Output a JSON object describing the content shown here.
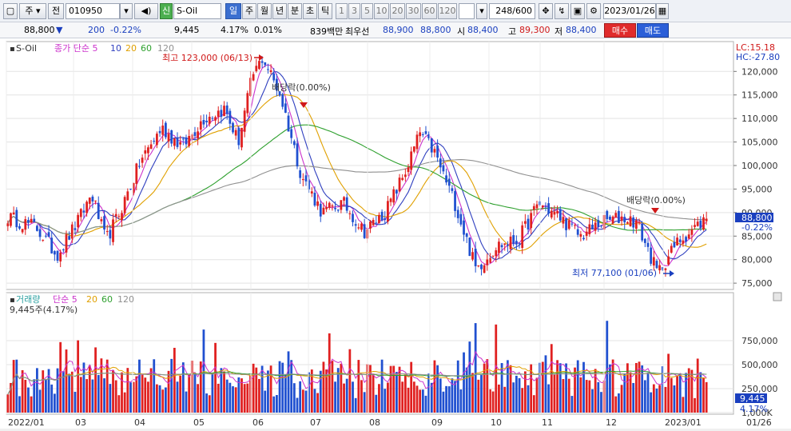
{
  "toolbar": {
    "code": "010950",
    "stock_name": "S-Oil",
    "type_label": "주",
    "jeon_label": "전",
    "sin_label": "신",
    "period_tabs": [
      "일",
      "주",
      "월",
      "년",
      "분",
      "초",
      "틱"
    ],
    "active_period": "일",
    "intervals": [
      "1",
      "3",
      "5",
      "10",
      "20",
      "30",
      "60",
      "120"
    ],
    "count_display": "248/600",
    "date": "2023/01/26"
  },
  "quote": {
    "price": "88,800",
    "change_arrow": "▼",
    "change": "200",
    "change_pct": "-0.22%",
    "volume": "9,445",
    "volume_pct": "4.17%",
    "turnover_pct": "0.01%",
    "amount": "839백만",
    "best_bid_label": "최우선",
    "best_ask": "88,900",
    "best_bid": "88,800",
    "open_label": "시",
    "open": "88,400",
    "high_label": "고",
    "high": "89,300",
    "low_label": "저",
    "low": "88,400",
    "buy_label": "매수",
    "sell_label": "매도"
  },
  "price_pane": {
    "legend_name": "S-Oil",
    "legend_items": [
      {
        "label": "종가 단순 5",
        "color": "#cc33cc"
      },
      {
        "label": "10",
        "color": "#2f3fbf"
      },
      {
        "label": "20",
        "color": "#e0a000"
      },
      {
        "label": "60",
        "color": "#2ea02e"
      },
      {
        "label": "120",
        "color": "#909090"
      }
    ],
    "lc_label": "LC:15.18",
    "hc_label": "HC:-27.80",
    "high_note": "최고 123,000 (06/13)",
    "low_note": "최저 77,100 (01/06)",
    "dividend_note_1": "배당락(0.00%)",
    "dividend_note_2": "배당락(0.00%)",
    "current_price_tag": "88,800",
    "current_change_tag": "-0.22%",
    "axis_labels": [
      "120,000",
      "115,000",
      "110,000",
      "105,000",
      "100,000",
      "95,000",
      "90,000",
      "85,000",
      "80,000",
      "75,000"
    ]
  },
  "volume_pane": {
    "legend_items": [
      {
        "label": "거래량",
        "color": "#2aa0a0"
      },
      {
        "label": "단순 5",
        "color": "#cc33cc"
      },
      {
        "label": "20",
        "color": "#e0a000"
      },
      {
        "label": "60",
        "color": "#2ea02e"
      },
      {
        "label": "120",
        "color": "#909090"
      }
    ],
    "current_note": "9,445주(4.17%)",
    "axis_labels": [
      "1,000K",
      "750,000",
      "500,000",
      "250,000"
    ],
    "current_tag": "9,445",
    "current_pct_tag": "4.17%"
  },
  "x_axis": {
    "labels": [
      "2022/01",
      "03",
      "04",
      "05",
      "06",
      "07",
      "08",
      "09",
      "10",
      "11",
      "12",
      "2023/01"
    ],
    "right_label": "01/26"
  },
  "chart_data": {
    "type": "candlestick",
    "price_range": [
      74000,
      126000
    ],
    "volume_range": [
      0,
      1150000
    ],
    "grid": true,
    "key_points": [
      {
        "t": 0.0,
        "p": 89000
      },
      {
        "t": 0.04,
        "p": 87000
      },
      {
        "t": 0.07,
        "p": 81000
      },
      {
        "t": 0.1,
        "p": 88000
      },
      {
        "t": 0.12,
        "p": 94000
      },
      {
        "t": 0.14,
        "p": 84000
      },
      {
        "t": 0.16,
        "p": 90000
      },
      {
        "t": 0.19,
        "p": 101000
      },
      {
        "t": 0.22,
        "p": 108000
      },
      {
        "t": 0.25,
        "p": 104000
      },
      {
        "t": 0.28,
        "p": 110000
      },
      {
        "t": 0.31,
        "p": 112000
      },
      {
        "t": 0.33,
        "p": 105000
      },
      {
        "t": 0.35,
        "p": 119000
      },
      {
        "t": 0.365,
        "p": 123000
      },
      {
        "t": 0.39,
        "p": 115000
      },
      {
        "t": 0.42,
        "p": 98000
      },
      {
        "t": 0.45,
        "p": 90000
      },
      {
        "t": 0.48,
        "p": 92000
      },
      {
        "t": 0.51,
        "p": 86000
      },
      {
        "t": 0.54,
        "p": 90000
      },
      {
        "t": 0.57,
        "p": 99000
      },
      {
        "t": 0.59,
        "p": 107000
      },
      {
        "t": 0.61,
        "p": 103000
      },
      {
        "t": 0.64,
        "p": 92000
      },
      {
        "t": 0.67,
        "p": 78000
      },
      {
        "t": 0.7,
        "p": 83000
      },
      {
        "t": 0.73,
        "p": 84000
      },
      {
        "t": 0.76,
        "p": 92000
      },
      {
        "t": 0.79,
        "p": 89000
      },
      {
        "t": 0.82,
        "p": 85000
      },
      {
        "t": 0.85,
        "p": 88000
      },
      {
        "t": 0.88,
        "p": 89000
      },
      {
        "t": 0.9,
        "p": 88000
      },
      {
        "t": 0.93,
        "p": 77100
      },
      {
        "t": 0.96,
        "p": 84000
      },
      {
        "t": 1.0,
        "p": 88800
      }
    ]
  }
}
